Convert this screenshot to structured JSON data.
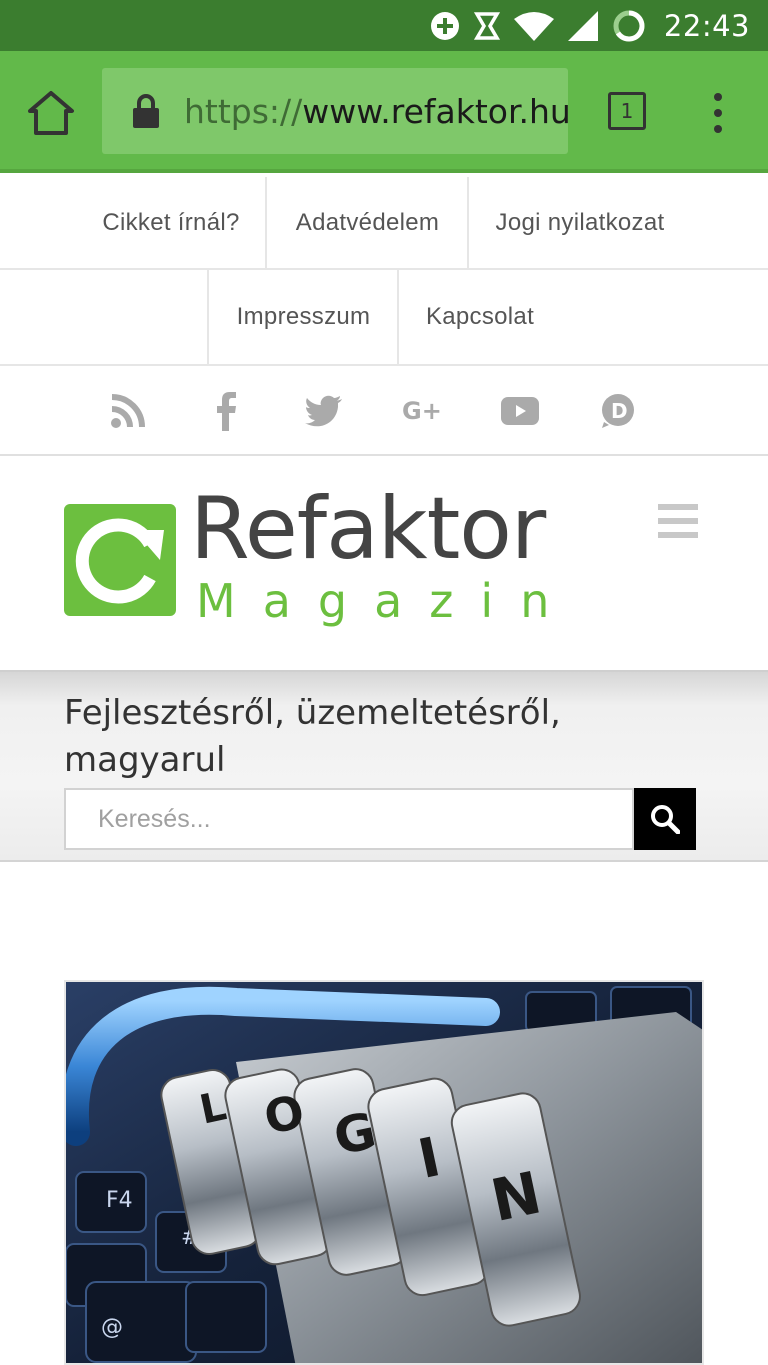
{
  "status_bar": {
    "time": "22:43",
    "icons": [
      "add-circle-icon",
      "sync-icon",
      "wifi-icon",
      "signal-icon",
      "battery-icon"
    ]
  },
  "browser": {
    "url_scheme": "https://",
    "url_host": "www.refaktor.hu",
    "tab_count": "1",
    "theme_color": "#62b94a"
  },
  "nav": {
    "row1": [
      "Cikket írnál?",
      "Adatvédelem",
      "Jogi nyilatkozat"
    ],
    "row2": [
      "Impresszum",
      "Kapcsolat"
    ]
  },
  "social": [
    "rss-icon",
    "facebook-icon",
    "twitter-icon",
    "google-plus-icon",
    "youtube-icon",
    "disqus-icon"
  ],
  "logo": {
    "wordmark": "Refaktor",
    "subtitle": "Magazin",
    "brand_color": "#6cbf3f"
  },
  "tagline": "Fejlesztésről, üzemeltetésről, magyarul",
  "search": {
    "placeholder": "Keresés..."
  },
  "article": {
    "image_subject": "combination lock on keyboard",
    "lock_letters": [
      "L",
      "O",
      "G",
      "I",
      "N"
    ]
  }
}
